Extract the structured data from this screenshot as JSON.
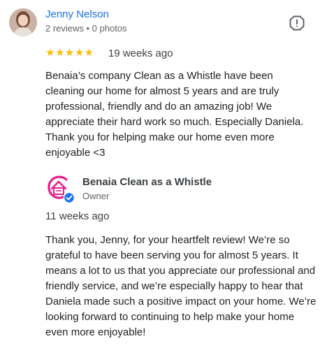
{
  "review": {
    "reviewer_name": "Jenny Nelson",
    "reviewer_meta": "2 reviews • 0 photos",
    "stars": "★★★★★",
    "rating": 5,
    "date": "19 weeks ago",
    "text": "Benaia’s company Clean as a Whistle have been cleaning our home for almost 5 years and are truly professional, friendly and do an amazing job! We appreciate their hard work so much. Especially Daniela. Thank you for helping make our home even more enjoyable <3"
  },
  "owner_response": {
    "business_name": "Benaia Clean as a Whistle",
    "role": "Owner",
    "date": "11 weeks ago",
    "text": "Thank you, Jenny, for your heartfelt review! We’re so grateful to have been serving you for almost 5 years. It means a lot to us that you appreciate our professional and friendly service, and we’re especially happy to hear that Daniela made such a positive impact on your home. We’re looking forward to continuing to help make your home even more enjoyable!"
  },
  "colors": {
    "name_link": "#1a73e8",
    "star": "#fbbc04",
    "verified_badge": "#1a73e8",
    "logo_pink": "#e91e8c"
  },
  "icons": {
    "report": "report-flag-icon",
    "verified": "verified-check-icon"
  }
}
